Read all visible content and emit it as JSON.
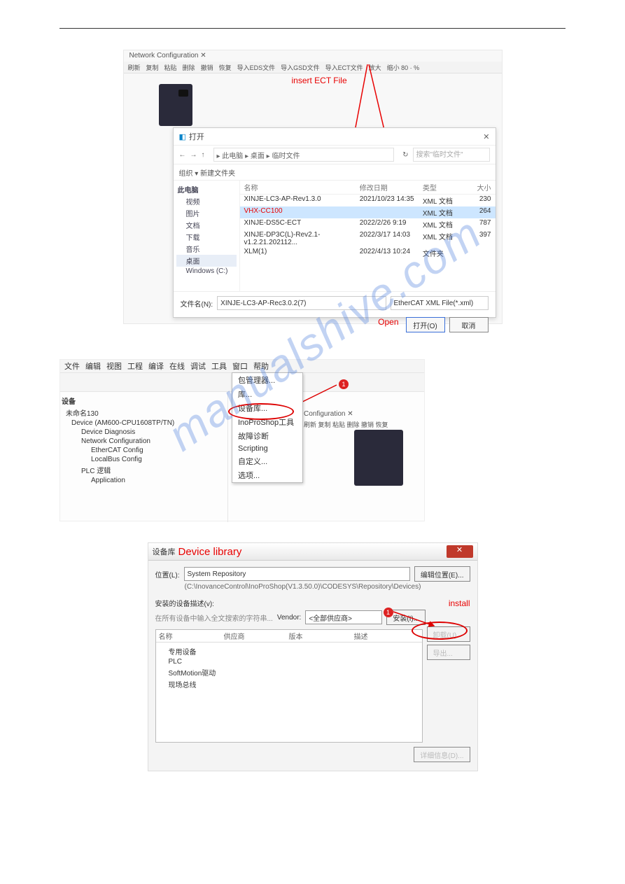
{
  "watermark": "manualshive.com",
  "fig1": {
    "tab": "Network Configuration  ✕",
    "toolbar": [
      "刷新",
      "复制",
      "粘贴",
      "删除",
      "撤销",
      "恢复",
      "导入EDS文件",
      "导入GSD文件",
      "导入ECT文件",
      "放大",
      "缩小  80    · %"
    ],
    "annot_insert": "insert ECT File",
    "annot_open": "Open",
    "dialog": {
      "title": "打开",
      "close": "✕",
      "nav_back": "←",
      "nav_fwd": "→",
      "nav_up": "↑",
      "crumb": "▸ 此电脑 ▸ 桌面 ▸ 临时文件",
      "search_placeholder": "搜索\"临时文件\"",
      "tb_left": "组织 ▾    新建文件夹",
      "side": [
        "此电脑",
        "视频",
        "图片",
        "文档",
        "下载",
        "音乐",
        "桌面",
        "Windows (C:)"
      ],
      "cols": [
        "名称",
        "修改日期",
        "类型",
        "大小"
      ],
      "rows": [
        {
          "n": "XINJE-LC3-AP-Rev1.3.0",
          "d": "2021/10/23 14:35",
          "t": "XML 文档",
          "s": "230"
        },
        {
          "n": "VHX-CC100",
          "d": "",
          "t": "XML 文档",
          "s": "264",
          "sel": true
        },
        {
          "n": "XINJE-DS5C-ECT",
          "d": "2022/2/26 9:19",
          "t": "XML 文档",
          "s": "787"
        },
        {
          "n": "XINJE-DP3C(L)-Rev2.1-v1.2.21.202112...",
          "d": "2022/3/17 14:03",
          "t": "XML 文档",
          "s": "397"
        },
        {
          "n": "XLM(1)",
          "d": "2022/4/13 10:24",
          "t": "文件夹",
          "s": ""
        }
      ],
      "fn_label": "文件名(N):",
      "fn_value": "XINJE-LC3-AP-Rec3.0.2(7)",
      "ft_value": "EtherCAT  XML  File(*.xml)",
      "open_btn": "打开(O)",
      "cancel_btn": "取消"
    }
  },
  "fig2": {
    "menu": [
      "文件",
      "编辑",
      "视图",
      "工程",
      "编译",
      "在线",
      "调试",
      "工具",
      "窗口",
      "帮助"
    ],
    "dropdown": [
      "包管理器...",
      "库...",
      "设备库...",
      "InoProShop工具",
      "故障诊断",
      "Scripting",
      "自定义...",
      "选项..."
    ],
    "tree_hdr": "设备",
    "tree": [
      {
        "t": "未命名130",
        "l": 0
      },
      {
        "t": "Device (AM600-CPU1608TP/TN)",
        "l": 1
      },
      {
        "t": "Device Diagnosis",
        "l": 2
      },
      {
        "t": "Network Configuration",
        "l": 2
      },
      {
        "t": "EtherCAT Config",
        "l": 3
      },
      {
        "t": "LocalBus Config",
        "l": 3
      },
      {
        "t": "PLC 逻辑",
        "l": 2
      },
      {
        "t": "Application",
        "l": 3
      }
    ],
    "cfg_tab": "Configuration  ✕",
    "cfg_tb": "刷新  复制  粘贴  删除  撤销  恢复"
  },
  "fig3": {
    "title_icon": "设备库",
    "title_red": "Device library",
    "loc_label": "位置(L):",
    "loc_value": "System Repository",
    "loc_path": "(C:\\InovanceControl\\InoProShop(V1.3.50.0)\\CODESYS\\Repository\\Devices)",
    "edit_btn": "编辑位置(E)...",
    "installed_label": "安装的设备描述(v):",
    "install_annot": "install",
    "search_label": "在所有设备中输入全文搜索的字符串...",
    "vendor_label": "Vendor:",
    "vendor_value": "<全部供应商>",
    "install_btn": "安装(I)...",
    "uninstall_btn": "卸载(U)",
    "export_btn": "导出...",
    "cols": [
      "名称",
      "供应商",
      "版本",
      "描述"
    ],
    "tree": [
      "专用设备",
      "PLC",
      "SoftMotion驱动",
      "现场总线"
    ],
    "detail_btn": "详细信息(D)..."
  }
}
